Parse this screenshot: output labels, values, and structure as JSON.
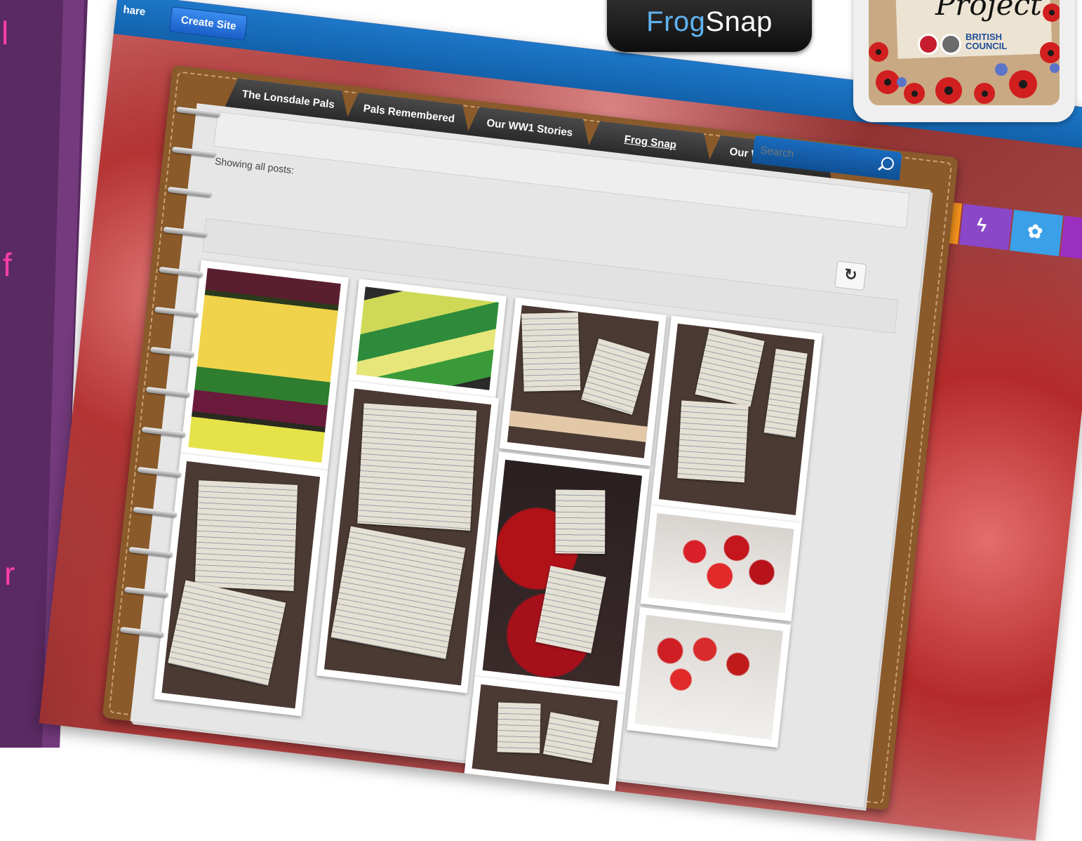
{
  "slide": {
    "left_glyph_1": "l",
    "left_glyph_2": "f",
    "left_glyph_3": "r"
  },
  "badge": {
    "frog": "Frog",
    "snap": "Snap"
  },
  "project_logo": {
    "word": "Project",
    "partner_line_1": "BRITISH",
    "partner_line_2": "COUNCIL"
  },
  "topbar": {
    "share_label": "hare",
    "create_site_label": "Create Site"
  },
  "tabs": [
    {
      "label": "The Lonsdale Pals"
    },
    {
      "label": "Pals Remembered"
    },
    {
      "label": "Our WW1 Stories"
    },
    {
      "label": "Frog Snap"
    },
    {
      "label": "Our WW1 Forum"
    }
  ],
  "search": {
    "placeholder": "Search",
    "icon": "search-icon"
  },
  "feed": {
    "showing_label": "Showing all posts:",
    "refresh_glyph": "↻"
  },
  "app_tiles": [
    {
      "name": "home-icon",
      "glyph": "⌂",
      "color": "#f7941d"
    },
    {
      "name": "lightning-icon",
      "glyph": "ϟ",
      "color": "#8a47c7"
    },
    {
      "name": "recycle-icon",
      "glyph": "✿",
      "color": "#3aa0e8"
    },
    {
      "name": "partial-tile",
      "glyph": "",
      "color": "#9b2fbf"
    }
  ],
  "colors": {
    "slide_purple": "#5a2a62",
    "slide_accent": "#ff3fa6",
    "topbar_blue": "#1e77c8",
    "notebook_brown": "#8a5a2b"
  }
}
